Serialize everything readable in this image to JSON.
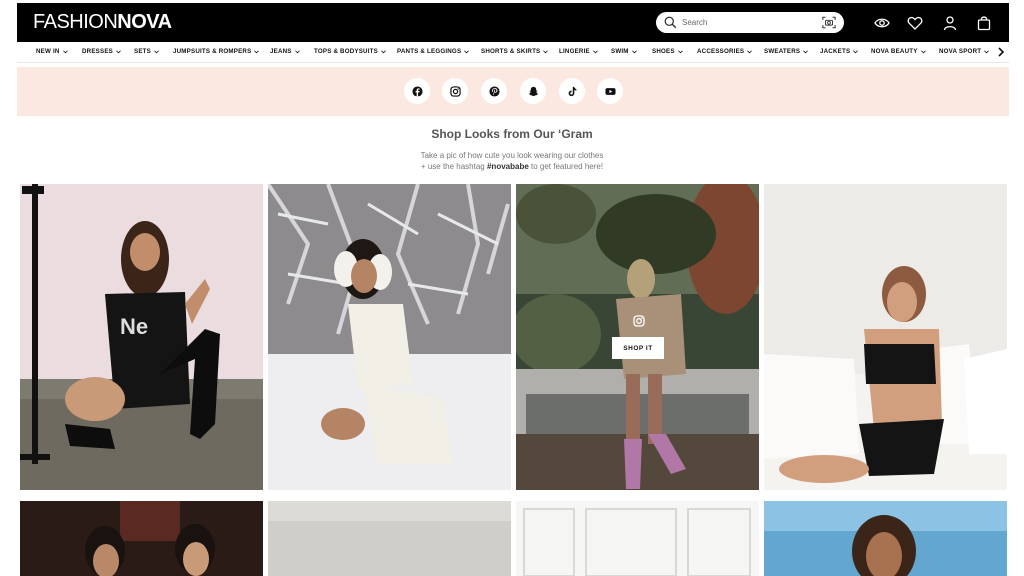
{
  "header": {
    "logo_thin": "FASHION",
    "logo_bold": "NOVA",
    "search_placeholder": "Search",
    "icons": [
      "search-icon",
      "camera-icon",
      "eye-icon",
      "heart-icon",
      "user-icon",
      "bag-icon"
    ]
  },
  "nav": {
    "items": [
      "NEW IN",
      "DRESSES",
      "SETS",
      "JUMPSUITS & ROMPERS",
      "JEANS",
      "TOPS & BODYSUITS",
      "PANTS & LEGGINGS",
      "SHORTS & SKIRTS",
      "LINGERIE",
      "SWIM",
      "SHOES",
      "ACCESSORIES",
      "SWEATERS",
      "JACKETS",
      "NOVA BEAUTY",
      "NOVA SPORT"
    ]
  },
  "social": {
    "icons": [
      "facebook-icon",
      "instagram-icon",
      "pinterest-icon",
      "snapchat-icon",
      "tiktok-icon",
      "youtube-icon"
    ],
    "band_color": "#fbe9e1"
  },
  "gram": {
    "title": "Shop Looks from Our ‘Gram",
    "line1": "Take a pic of how cute you look wearing our clothes",
    "line2_pre": "+ use the hashtag ",
    "hashtag": "#novababe",
    "line2_post": " to get featured here!",
    "shop_it_label": "SHOP IT"
  },
  "colors": {
    "header_bg": "#000000",
    "accent_band": "#fbe9e1"
  }
}
